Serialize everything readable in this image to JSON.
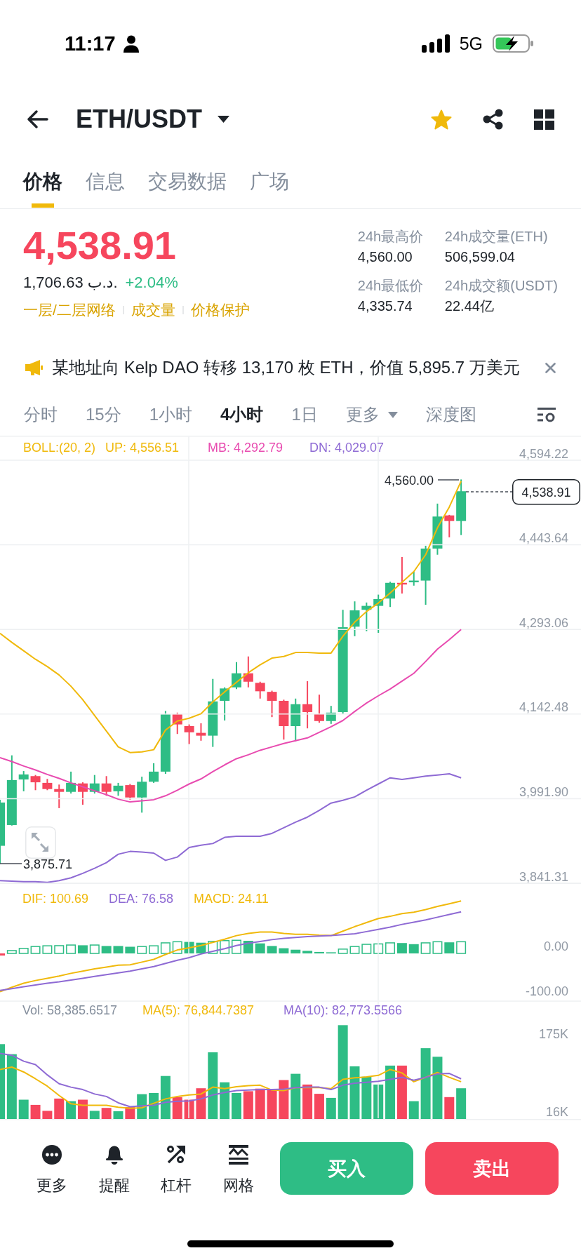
{
  "status_bar": {
    "time": "11:17",
    "network": "5G"
  },
  "header": {
    "pair": "ETH/USDT",
    "favorite": true
  },
  "tabs": [
    {
      "label": "价格",
      "selected": true
    },
    {
      "label": "信息",
      "selected": false
    },
    {
      "label": "交易数据",
      "selected": false
    },
    {
      "label": "广场",
      "selected": false
    }
  ],
  "price": {
    "last": "4,538.91",
    "fiat": "1,706.63 د.ب.",
    "change": "+2.04%",
    "tags": [
      "一层/二层网络",
      "成交量",
      "价格保护"
    ]
  },
  "stats": [
    {
      "label": "24h最高价",
      "value": "4,560.00"
    },
    {
      "label": "24h成交量(ETH)",
      "value": "506,599.04"
    },
    {
      "label": "24h最低价",
      "value": "4,335.74"
    },
    {
      "label": "24h成交额(USDT)",
      "value": "22.44亿"
    }
  ],
  "announcement": {
    "text": "某地址向 Kelp DAO 转移 13,170 枚 ETH，价值 5,895.7 万美元"
  },
  "intervals": [
    {
      "label": "分时",
      "selected": false,
      "kind": "option"
    },
    {
      "label": "15分",
      "selected": false,
      "kind": "option"
    },
    {
      "label": "1小时",
      "selected": false,
      "kind": "option"
    },
    {
      "label": "4小时",
      "selected": true,
      "kind": "option"
    },
    {
      "label": "1日",
      "selected": false,
      "kind": "option"
    },
    {
      "label": "更多",
      "selected": false,
      "kind": "dropdown"
    },
    {
      "label": "深度图",
      "selected": false,
      "kind": "option"
    }
  ],
  "chart": {
    "high_marker": "4,560.00",
    "low_marker": "3,875.71",
    "last_price": "4,538.91",
    "chart_data": {
      "type": "candlestick",
      "categories": [
        null,
        null,
        null,
        null,
        null,
        null,
        null,
        null,
        null,
        null,
        null,
        null,
        null,
        null,
        null,
        null,
        null,
        null,
        null,
        null,
        null,
        null,
        null,
        null,
        null,
        null,
        null,
        null,
        null,
        null,
        null,
        null,
        null,
        null,
        null,
        null,
        null,
        null,
        null,
        null
      ],
      "ohlc": [
        [
          3908,
          3990,
          3876,
          3985
        ],
        [
          3945,
          4069,
          3944,
          4025
        ],
        [
          4026,
          4041,
          4005,
          4035
        ],
        [
          4032,
          4034,
          4007,
          4021
        ],
        [
          4020,
          4027,
          4007,
          4009
        ],
        [
          4009,
          4017,
          3975,
          4004
        ],
        [
          4004,
          4040,
          4001,
          4020
        ],
        [
          4019,
          4021,
          3981,
          4004
        ],
        [
          4004,
          4034,
          4001,
          4019
        ],
        [
          4019,
          4032,
          3997,
          4004
        ],
        [
          4005,
          4020,
          3997,
          4015
        ],
        [
          4016,
          4018,
          3990,
          3994
        ],
        [
          3994,
          4031,
          3967,
          4022
        ],
        [
          4022,
          4055,
          4020,
          4040
        ],
        [
          4040,
          4148,
          4036,
          4142
        ],
        [
          4142,
          4145,
          4107,
          4124
        ],
        [
          4121,
          4124,
          4089,
          4110
        ],
        [
          4109,
          4126,
          4095,
          4104
        ],
        [
          4104,
          4205,
          4084,
          4165
        ],
        [
          4166,
          4190,
          4131,
          4188
        ],
        [
          4190,
          4235,
          4187,
          4215
        ],
        [
          4215,
          4245,
          4190,
          4200
        ],
        [
          4198,
          4200,
          4170,
          4183
        ],
        [
          4182,
          4184,
          4137,
          4166
        ],
        [
          4166,
          4168,
          4097,
          4121
        ],
        [
          4121,
          4170,
          4094,
          4160
        ],
        [
          4160,
          4201,
          4117,
          4146
        ],
        [
          4143,
          4177,
          4127,
          4130
        ],
        [
          4130,
          4157,
          4125,
          4145
        ],
        [
          4146,
          4328,
          4143,
          4297
        ],
        [
          4298,
          4343,
          4281,
          4327
        ],
        [
          4328,
          4341,
          4290,
          4335
        ],
        [
          4335,
          4355,
          4287,
          4347
        ],
        [
          4348,
          4378,
          4333,
          4376
        ],
        [
          4376,
          4422,
          4357,
          4373
        ],
        [
          4377,
          4396,
          4371,
          4380
        ],
        [
          4380,
          4442,
          4337,
          4437
        ],
        [
          4437,
          4517,
          4426,
          4494
        ],
        [
          4496,
          4497,
          4457,
          4486
        ],
        [
          4486,
          4560,
          4461,
          4539
        ]
      ],
      "yticks": [
        {
          "value": 4594.22,
          "label": "4,594.22"
        },
        {
          "value": 3841.31,
          "label": "3,841.31"
        }
      ],
      "ylim": [
        3841.31,
        4594.22
      ],
      "grid": true
    }
  },
  "bollinger": {
    "chart_data": {
      "type": "line",
      "title": "BOLL:(20, 2)",
      "categories": [
        null,
        null,
        null,
        null,
        null,
        null,
        null,
        null,
        null,
        null,
        null,
        null,
        null,
        null,
        null,
        null,
        null,
        null,
        null,
        null,
        null,
        null,
        null,
        null,
        null,
        null,
        null,
        null,
        null,
        null,
        null,
        null,
        null,
        null,
        null,
        null,
        null,
        null,
        null,
        null
      ],
      "series": [
        {
          "name": "UP: 4,556.51",
          "color": "#f0b90b",
          "values": [
            4286,
            4270,
            4255,
            4240,
            4227,
            4212,
            4192,
            4168,
            4140,
            4112,
            4084,
            4074,
            4075,
            4079,
            4114,
            4130,
            4135,
            4143,
            4164,
            4182,
            4199,
            4216,
            4230,
            4242,
            4245,
            4252,
            4252,
            4251,
            4251,
            4281,
            4306,
            4325,
            4340,
            4358,
            4377,
            4396,
            4426,
            4474,
            4511,
            4557
          ]
        },
        {
          "name": "MB: 4,292.79",
          "color": "#e84bb0",
          "values": [
            4065,
            4058,
            4050,
            4043,
            4035,
            4028,
            4020,
            4013,
            4006,
            3999,
            3991,
            3986,
            3988,
            3990,
            3997,
            4007,
            4018,
            4027,
            4040,
            4052,
            4063,
            4070,
            4078,
            4084,
            4090,
            4095,
            4100,
            4110,
            4120,
            4131,
            4147,
            4162,
            4175,
            4187,
            4201,
            4215,
            4236,
            4258,
            4275,
            4293
          ]
        },
        {
          "name": "DN: 4,029.07",
          "color": "#8e6ad4",
          "values": [
            3846,
            3845,
            3844,
            3844,
            3843,
            3846,
            3851,
            3859,
            3868,
            3878,
            3893,
            3898,
            3897,
            3895,
            3882,
            3888,
            3905,
            3909,
            3912,
            3923,
            3925,
            3925,
            3925,
            3930,
            3940,
            3950,
            3959,
            3971,
            3984,
            3989,
            3995,
            4007,
            4018,
            4029,
            4026,
            4029,
            4032,
            4034,
            4036,
            4029
          ]
        }
      ],
      "yticks": [
        {
          "value": 4443.64,
          "label": "4,443.64"
        },
        {
          "value": 4293.06,
          "label": "4,293.06"
        },
        {
          "value": 4142.48,
          "label": "4,142.48"
        },
        {
          "value": 3991.9,
          "label": "3,991.90"
        }
      ],
      "ylim": [
        3841.31,
        4637.92
      ],
      "grid": true
    }
  },
  "macd": {
    "histogram_label": "MACD: 24.11",
    "chart_data": {
      "type": "line",
      "categories": [
        null,
        null,
        null,
        null,
        null,
        null,
        null,
        null,
        null,
        null,
        null,
        null,
        null,
        null,
        null,
        null,
        null,
        null,
        null,
        null,
        null,
        null,
        null,
        null,
        null,
        null,
        null,
        null,
        null,
        null,
        null,
        null,
        null,
        null,
        null,
        null,
        null,
        null,
        null,
        null
      ],
      "series": [
        {
          "name": "DIF: 100.69",
          "color": "#f0b90b",
          "values": [
            -101,
            -91,
            -82,
            -76,
            -71,
            -66,
            -60,
            -55,
            -50,
            -46,
            -42,
            -41,
            -35,
            -29,
            -18,
            -8,
            -3,
            2,
            9,
            16,
            24,
            29,
            32,
            32,
            29,
            27,
            27,
            25,
            24,
            34,
            44,
            53,
            62,
            67,
            73,
            76,
            82,
            89,
            95,
            101
          ]
        },
        {
          "name": "DEA: 76.58",
          "color": "#8e6ad4",
          "values": [
            -98,
            -94,
            -90,
            -86,
            -82,
            -79,
            -75,
            -71,
            -67,
            -63,
            -59,
            -55,
            -50,
            -45,
            -38,
            -31,
            -25,
            -17,
            -11,
            -5,
            2,
            7,
            11,
            15,
            18,
            20,
            22,
            23,
            24,
            26,
            28,
            33,
            38,
            43,
            49,
            54,
            59,
            65,
            71,
            77
          ]
        }
      ],
      "yticks": [
        {
          "value": 0,
          "label": "0.00"
        },
        {
          "value": -100,
          "label": "-100.00"
        }
      ],
      "ylim": [
        -121.9,
        140.6
      ],
      "grid": true
    }
  },
  "volume": {
    "label": "Vol: 58,385.6517",
    "chart_data": {
      "type": "line",
      "categories": [
        null,
        null,
        null,
        null,
        null,
        null,
        null,
        null,
        null,
        null,
        null,
        null,
        null,
        null,
        null,
        null,
        null,
        null,
        null,
        null,
        null,
        null,
        null,
        null,
        null,
        null,
        null,
        null,
        null,
        null,
        null,
        null,
        null,
        null,
        null,
        null,
        null,
        null,
        null,
        null
      ],
      "series": [
        {
          "name": "MA(5): 76,844.7387",
          "color": "#f0b90b",
          "values": [
            102000,
            107000,
            97000,
            83000,
            68000,
            49000,
            32000,
            29000,
            29000,
            29000,
            25000,
            23000,
            24000,
            33000,
            42000,
            47000,
            50000,
            52000,
            66000,
            63000,
            67000,
            69000,
            70000,
            60000,
            59000,
            65000,
            65000,
            65000,
            63000,
            82000,
            85000,
            87000,
            90000,
            102000,
            95000,
            77000,
            86000,
            96000,
            86000,
            77000
          ]
        },
        {
          "name": "MA(10): 82,773.5566",
          "color": "#8e6ad4",
          "values": [
            135000,
            131000,
            119000,
            112000,
            91000,
            73000,
            66000,
            61000,
            52000,
            47000,
            34000,
            26000,
            28000,
            29000,
            35000,
            37000,
            38000,
            42000,
            50000,
            55000,
            59000,
            60000,
            61000,
            61000,
            62000,
            65000,
            66000,
            66000,
            61000,
            70000,
            74000,
            76000,
            78000,
            82000,
            86000,
            80000,
            86000,
            93000,
            94000,
            83000
          ]
        }
      ],
      "yticks": [
        {
          "value": 175000,
          "label": "175K"
        },
        {
          "value": 16000,
          "label": "16K"
        }
      ],
      "ylim": [
        0,
        175000
      ],
      "grid": true
    }
  },
  "bottom_bar": {
    "tools": [
      {
        "label": "更多",
        "kind": "more"
      },
      {
        "label": "提醒",
        "kind": "alert"
      },
      {
        "label": "杠杆",
        "kind": "leverage"
      },
      {
        "label": "网格",
        "kind": "grid"
      }
    ],
    "buy": "买入",
    "sell": "卖出"
  }
}
